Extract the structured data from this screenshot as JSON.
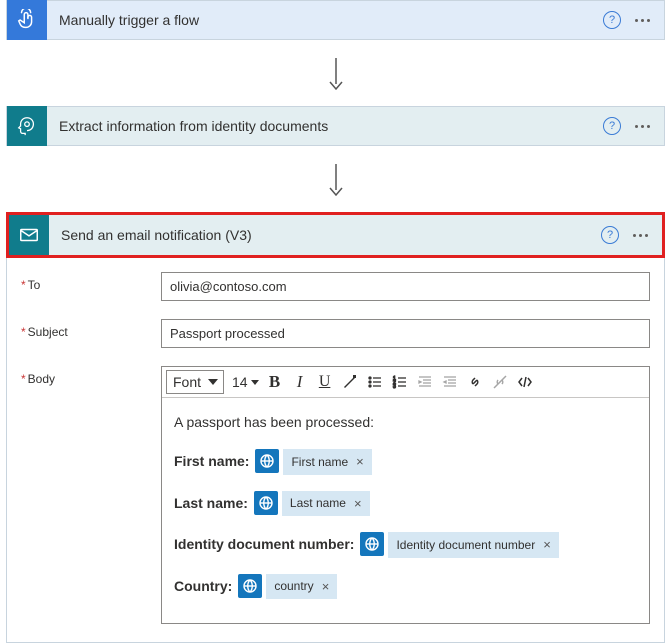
{
  "steps": {
    "manual": {
      "title": "Manually trigger a flow"
    },
    "extract": {
      "title": "Extract information from identity documents"
    },
    "email": {
      "title": "Send an email notification (V3)"
    }
  },
  "form": {
    "to_label": "To",
    "to_value": "olivia@contoso.com",
    "subject_label": "Subject",
    "subject_value": "Passport processed",
    "body_label": "Body"
  },
  "toolbar": {
    "font_label": "Font",
    "size_label": "14"
  },
  "editor": {
    "intro": "A passport has been processed:",
    "fields": {
      "first_name_label": "First name:",
      "first_name_token": "First name",
      "last_name_label": "Last name:",
      "last_name_token": "Last name",
      "idnum_label": "Identity document number:",
      "idnum_token": "Identity document number",
      "country_label": "Country:",
      "country_token": "country"
    }
  }
}
